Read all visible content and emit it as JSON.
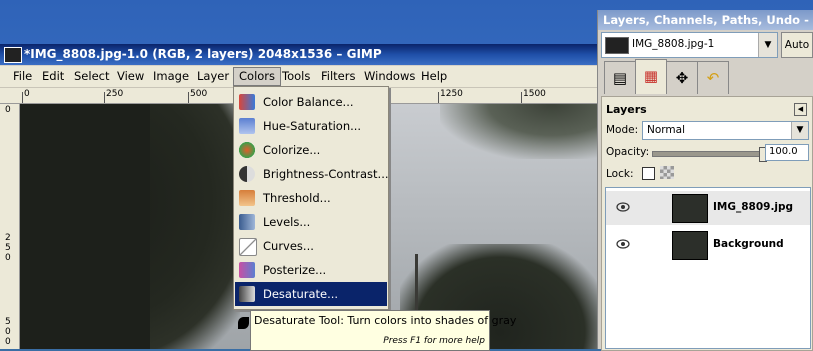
{
  "window": {
    "title": "*IMG_8808.jpg-1.0 (RGB, 2 layers) 2048x1536 – GIMP"
  },
  "menubar": [
    {
      "label": "File"
    },
    {
      "label": "Edit"
    },
    {
      "label": "Select"
    },
    {
      "label": "View"
    },
    {
      "label": "Image"
    },
    {
      "label": "Layer"
    },
    {
      "label": "Colors"
    },
    {
      "label": "Tools"
    },
    {
      "label": "Filters"
    },
    {
      "label": "Windows"
    },
    {
      "label": "Help"
    }
  ],
  "ruler": {
    "labels": [
      "0",
      "250",
      "500",
      "1250",
      "1500"
    ],
    "vertical_labels": [
      "0",
      "2",
      "5",
      "0",
      "5",
      "0",
      "0"
    ]
  },
  "colors_menu": [
    {
      "label": "Color Balance...",
      "icon": "color-balance-icon",
      "color": "#d9463a"
    },
    {
      "label": "Hue-Saturation...",
      "icon": "hue-saturation-icon",
      "color": "#5b7fd1"
    },
    {
      "label": "Colorize...",
      "icon": "colorize-icon",
      "color": "#e25c2b"
    },
    {
      "label": "Brightness-Contrast...",
      "icon": "brightness-contrast-icon",
      "color": "#888888"
    },
    {
      "label": "Threshold...",
      "icon": "threshold-icon",
      "color": "#d67e3a"
    },
    {
      "label": "Levels...",
      "icon": "levels-icon",
      "color": "#3a5c8f"
    },
    {
      "label": "Curves...",
      "icon": "curves-icon",
      "color": "#7a7a7a"
    },
    {
      "label": "Posterize...",
      "icon": "posterize-icon",
      "color": "#c94fa3"
    },
    {
      "label": "Desaturate...",
      "icon": "desaturate-icon",
      "color": "#9a9a9a",
      "selected": true
    }
  ],
  "tooltip": {
    "text": "Desaturate Tool: Turn colors into shades of gray",
    "hint": "Press F1 for more help"
  },
  "dock": {
    "title": "Layers, Channels, Paths, Undo - B...",
    "image_select": "IMG_8808.jpg-1",
    "auto_label": "Auto",
    "panel_title": "Layers",
    "mode_label": "Mode:",
    "mode_value": "Normal",
    "opacity_label": "Opacity:",
    "opacity_value": "100.0",
    "lock_label": "Lock:",
    "layers": [
      {
        "name": "IMG_8809.jpg",
        "selected": true
      },
      {
        "name": "Background",
        "selected": false
      }
    ]
  },
  "colors": {
    "titlebar": "#0a246a",
    "menu_selection": "#0a246a",
    "tooltip_bg": "#ffffe1"
  }
}
